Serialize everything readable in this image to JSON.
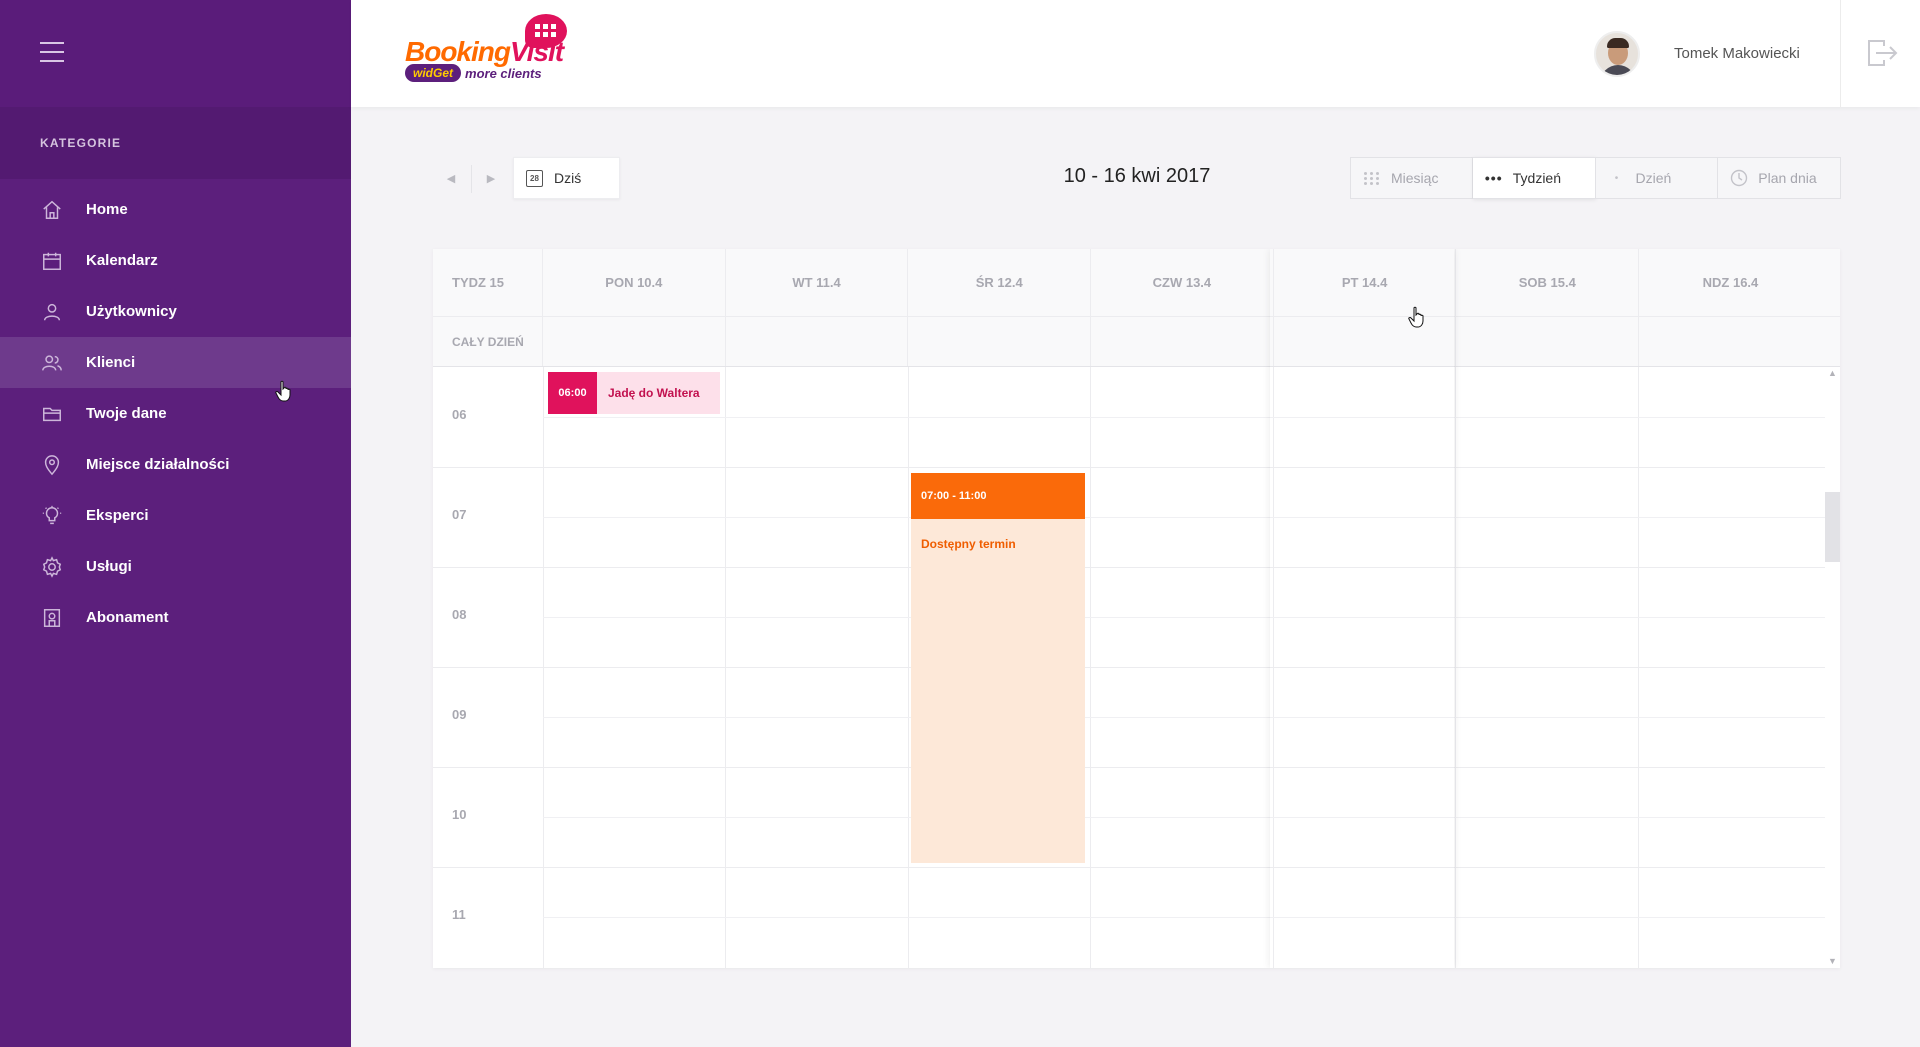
{
  "sidebar": {
    "section_title": "KATEGORIE",
    "items": [
      {
        "label": "Home",
        "icon": "home-icon"
      },
      {
        "label": "Kalendarz",
        "icon": "calendar-icon"
      },
      {
        "label": "Użytkownicy",
        "icon": "user-icon"
      },
      {
        "label": "Klienci",
        "icon": "users-icon",
        "active": true
      },
      {
        "label": "Twoje dane",
        "icon": "folder-icon"
      },
      {
        "label": "Miejsce działalności",
        "icon": "location-pin-icon"
      },
      {
        "label": "Eksperci",
        "icon": "lightbulb-icon"
      },
      {
        "label": "Usługi",
        "icon": "gear-icon"
      },
      {
        "label": "Abonament",
        "icon": "subscription-icon"
      }
    ]
  },
  "header": {
    "logo": {
      "booking": "Booking",
      "visit": "Visit",
      "widget": "widGet",
      "tagline": "more clients"
    },
    "user_name": "Tomek Makowiecki"
  },
  "toolbar": {
    "today_label": "Dziś",
    "today_icon_day": "28",
    "date_range": "10 - 16 kwi 2017",
    "views": [
      {
        "label": "Miesiąc",
        "active": false
      },
      {
        "label": "Tydzień",
        "active": true
      },
      {
        "label": "Dzień",
        "active": false
      },
      {
        "label": "Plan dnia",
        "active": false
      }
    ]
  },
  "calendar": {
    "week_label": "TYDZ 15",
    "allday_label": "CAŁY DZIEŃ",
    "days": [
      "PON 10.4",
      "WT 11.4",
      "ŚR 12.4",
      "CZW 13.4",
      "PT 14.4",
      "SOB 15.4",
      "NDZ 16.4"
    ],
    "hours": [
      "06",
      "07",
      "08",
      "09",
      "10",
      "11"
    ],
    "events": [
      {
        "time": "06:00",
        "title": "Jadę do Waltera",
        "color": "#e0125c"
      },
      {
        "time": "07:00 - 11:00",
        "title": "Dostępny termin",
        "color": "#fa6a0a"
      }
    ]
  },
  "colors": {
    "sidebar": "#5c1f7c",
    "accent_pink": "#e0125c",
    "accent_orange": "#fa6a0a"
  }
}
